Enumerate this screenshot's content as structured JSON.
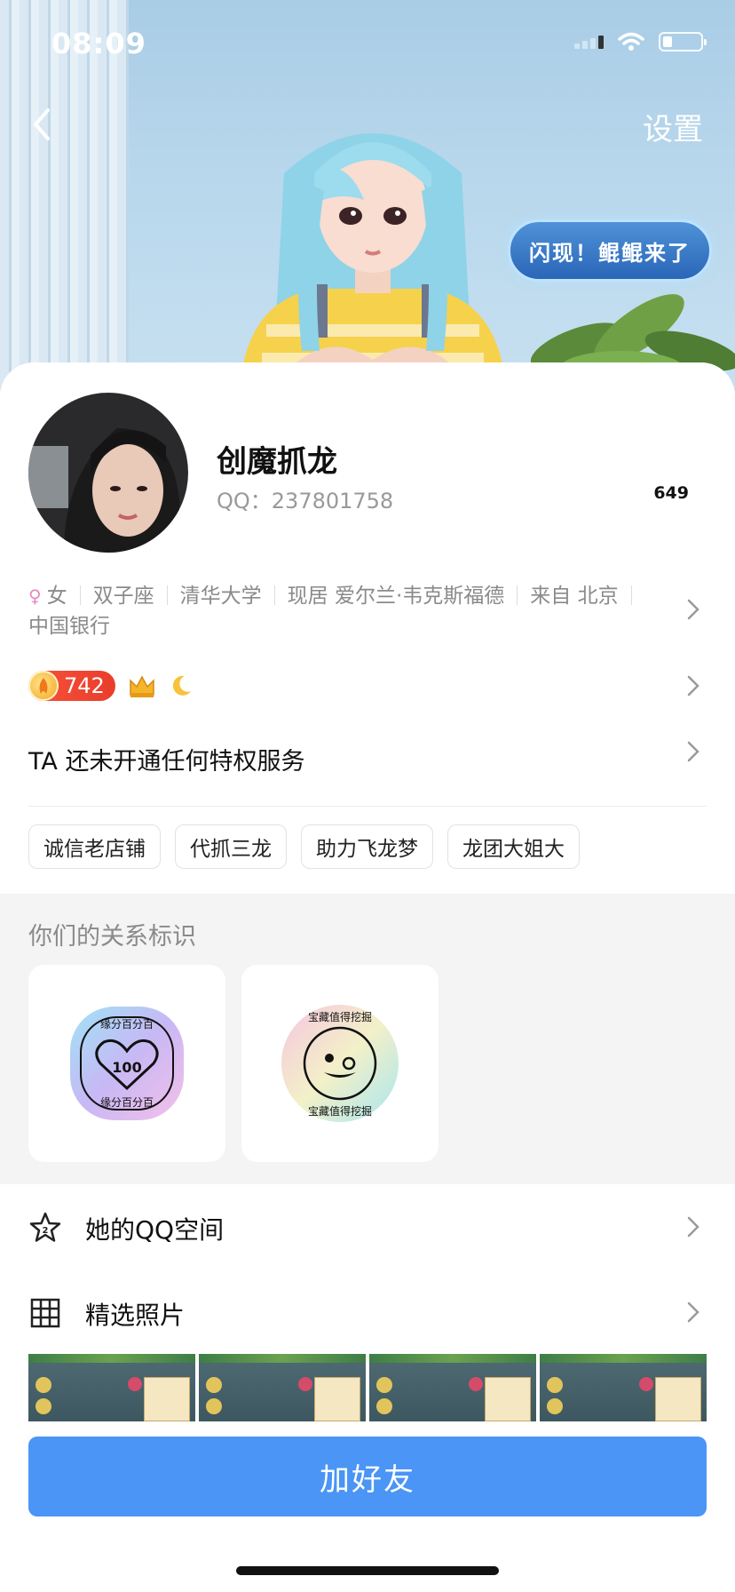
{
  "status_bar": {
    "time": "08:09"
  },
  "header": {
    "settings_label": "设置",
    "flash_badge": "闪现！鲲鲲来了"
  },
  "profile": {
    "nickname": "创魔抓龙",
    "qq_number": "QQ：237801758",
    "like_count": "649",
    "info": {
      "gender": "女",
      "zodiac": "双子座",
      "school": "清华大学",
      "residence": "现居 爱尔兰·韦克斯福德",
      "hometown": "来自 北京",
      "company": "中国银行"
    },
    "level_value": "742",
    "privilege_text": "TA 还未开通任何特权服务",
    "tags": [
      "诚信老店铺",
      "代抓三龙",
      "助力飞龙梦",
      "龙团大姐大"
    ]
  },
  "relations": {
    "title": "你们的关系标识",
    "badges": [
      {
        "name": "heart-badge",
        "text_top": "缘分百分百",
        "text_bottom": "缘分百分百",
        "center": "100"
      },
      {
        "name": "smiley-badge",
        "text_top": "宝藏值得挖掘",
        "text_bottom": "宝藏值得挖掘"
      }
    ]
  },
  "menu": {
    "qzone_label": "她的QQ空间",
    "photos_label": "精选照片"
  },
  "add_friend_label": "加好友",
  "colors": {
    "accent": "#4a95f5",
    "gender": "#e58bbf",
    "coin_badge": "#e93d2c"
  }
}
